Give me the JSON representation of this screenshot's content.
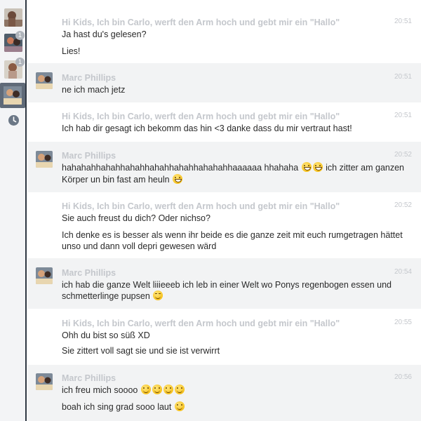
{
  "sidebar": {
    "items": [
      {
        "name": "contact-1",
        "badge": ""
      },
      {
        "name": "contact-2",
        "badge": "1"
      },
      {
        "name": "contact-3",
        "badge": "1"
      },
      {
        "name": "contact-4-selected",
        "badge": ""
      }
    ],
    "history_icon": "clock-icon"
  },
  "chat": {
    "messages": [
      {
        "sender": "Hi Kids, Ich bin Carlo, werft den Arm hoch und gebt mir ein \"Hallo\"",
        "time": "20:51",
        "lines": [
          "Ja hast du's gelesen?",
          "Lies!"
        ]
      },
      {
        "sender": "Marc Phillips",
        "time": "20:51",
        "lines": [
          "ne ich mach jetz"
        ]
      },
      {
        "sender": "Hi Kids, Ich bin Carlo, werft den Arm hoch und gebt mir ein \"Hallo\"",
        "time": "20:51",
        "lines": [
          "Ich hab dir gesagt ich bekomm das hin <3 danke dass du mir vertraut hast!"
        ]
      },
      {
        "sender": "Marc Phillips",
        "time": "20:52",
        "lines": [
          "hahahahhahahhahahhahahhahahhahahahhaaaaaa hhahaha",
          "ich zitter am ganzen",
          "Körper un bin fast am heuln"
        ]
      },
      {
        "sender": "Hi Kids, Ich bin Carlo, werft den Arm hoch und gebt mir ein \"Hallo\"",
        "time": "20:52",
        "lines": [
          "Sie auch freust du dich? Oder nichso?",
          "Ich denke es is besser als wenn ihr beide es die ganze zeit mit euch rumgetragen hättet",
          "unso und dann voll depri gewesen wärd"
        ]
      },
      {
        "sender": "Marc Phillips",
        "time": "20:54",
        "lines": [
          "ich hab die ganze Welt liiieeeb ich leb in einer Welt wo Ponys regenbogen essen und",
          "schmetterlinge pupsen"
        ]
      },
      {
        "sender": "Hi Kids, Ich bin Carlo, werft den Arm hoch und gebt mir ein \"Hallo\"",
        "time": "20:55",
        "lines": [
          "Ohh du bist so süß XD",
          "Sie zittert voll sagt sie und sie ist verwirrt"
        ]
      },
      {
        "sender": "Marc Phillips",
        "time": "20:56",
        "lines": [
          "ich freu mich soooo",
          "boah ich sing grad sooo laut"
        ]
      }
    ],
    "emoji_names": [
      "grin-emoji",
      "smile-emoji",
      "wink-emoji"
    ]
  }
}
